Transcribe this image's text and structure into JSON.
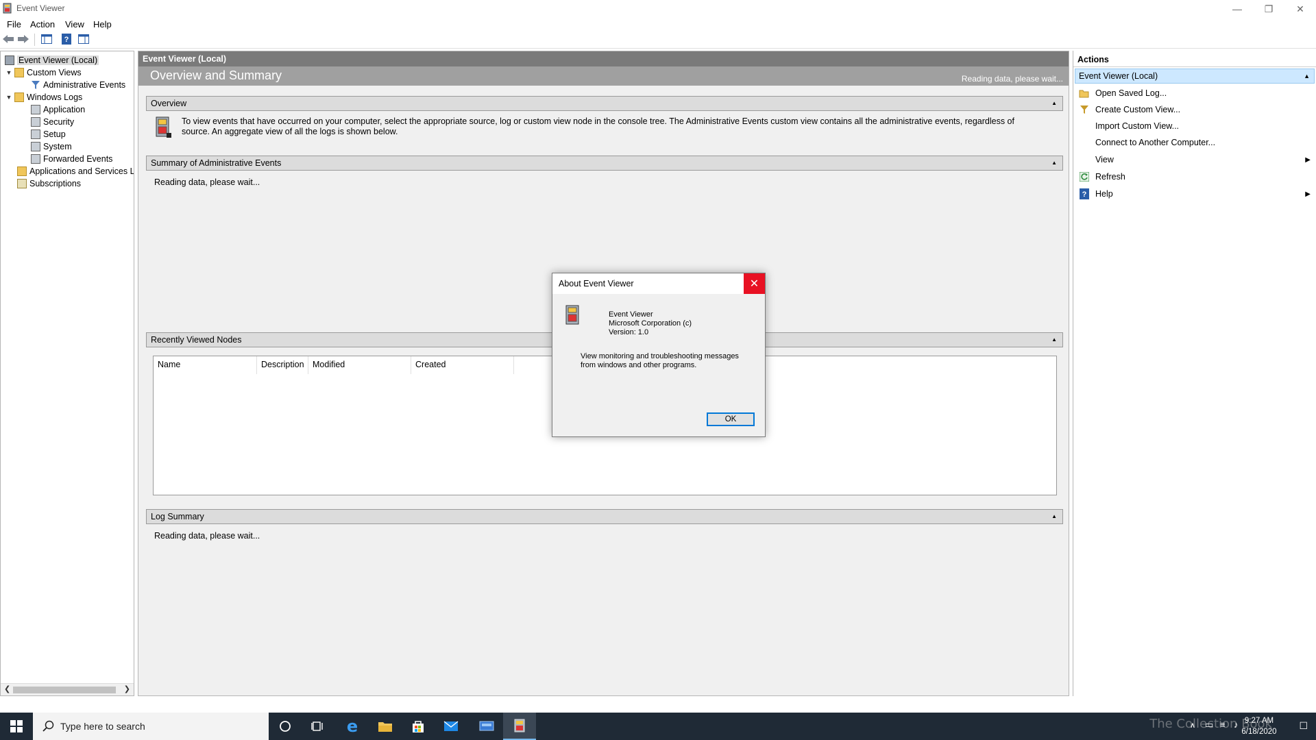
{
  "window": {
    "title": "Event Viewer"
  },
  "menu": [
    "File",
    "Action",
    "View",
    "Help"
  ],
  "tree": {
    "items": [
      {
        "label": "Event Viewer (Local)",
        "level": 0,
        "expander": "",
        "selected": true
      },
      {
        "label": "Custom Views",
        "level": 0,
        "expander": "▼"
      },
      {
        "label": "Administrative Events",
        "level": 1,
        "expander": ""
      },
      {
        "label": "Windows Logs",
        "level": 0,
        "expander": "▼"
      },
      {
        "label": "Application",
        "level": 1,
        "expander": ""
      },
      {
        "label": "Security",
        "level": 1,
        "expander": ""
      },
      {
        "label": "Setup",
        "level": 1,
        "expander": ""
      },
      {
        "label": "System",
        "level": 1,
        "expander": ""
      },
      {
        "label": "Forwarded Events",
        "level": 1,
        "expander": ""
      },
      {
        "label": "Applications and Services Lo",
        "level": 0,
        "expander": ""
      },
      {
        "label": "Subscriptions",
        "level": 0,
        "expander": ""
      }
    ]
  },
  "center": {
    "header": "Event Viewer (Local)",
    "title": "Overview and Summary",
    "status": "Reading data, please wait...",
    "overview": {
      "heading": "Overview",
      "text": "To view events that have occurred on your computer, select the appropriate source, log or custom view node in the console tree. The Administrative Events custom view contains all the administrative events, regardless of source. An aggregate view of all the logs is shown below."
    },
    "summary": {
      "heading": "Summary of Administrative Events",
      "text": "Reading data, please wait..."
    },
    "recent": {
      "heading": "Recently Viewed Nodes",
      "columns": [
        "Name",
        "Description",
        "Modified",
        "Created"
      ]
    },
    "log_summary": {
      "heading": "Log Summary",
      "text": "Reading data, please wait..."
    }
  },
  "actions": {
    "title": "Actions",
    "group": "Event Viewer (Local)",
    "items": [
      {
        "label": "Open Saved Log...",
        "icon": "open-folder-icon",
        "submenu": false
      },
      {
        "label": "Create Custom View...",
        "icon": "filter-icon",
        "submenu": false
      },
      {
        "label": "Import Custom View...",
        "icon": "",
        "submenu": false
      },
      {
        "label": "Connect to Another Computer...",
        "icon": "",
        "submenu": false
      },
      {
        "label": "View",
        "icon": "",
        "submenu": true
      },
      {
        "label": "Refresh",
        "icon": "refresh-icon",
        "submenu": false
      },
      {
        "label": "Help",
        "icon": "help-icon",
        "submenu": true
      }
    ]
  },
  "dialog": {
    "title": "About Event Viewer",
    "product": "Event Viewer",
    "company": "Microsoft Corporation (c)",
    "version": "Version: 1.0",
    "description_line1": "View monitoring and troubleshooting messages",
    "description_line2": "from windows and other programs.",
    "ok_label": "OK"
  },
  "taskbar": {
    "search_placeholder": "Type here to search",
    "time": "9:27 AM",
    "date": "6/18/2020",
    "watermark": "The Collection Book"
  },
  "colors": {
    "accent": "#0078d7",
    "close_red": "#e81123",
    "selection_blue": "#cde8ff",
    "taskbar": "#1f2a36"
  }
}
